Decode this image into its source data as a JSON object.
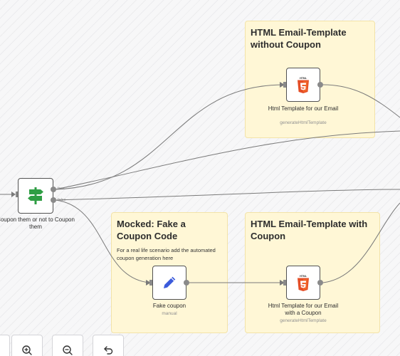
{
  "stickies": {
    "no_coupon": {
      "title": "HTML Email-Template without Coupon"
    },
    "fake_coupon": {
      "title": "Mocked: Fake a Coupon Code",
      "body": "For a real life scenario add the automated coupon generation here"
    },
    "with_coupon": {
      "title": "HTML Email-Template with Coupon"
    }
  },
  "nodes": {
    "switch": {
      "label": "Coupon them or not to Coupon them",
      "branch_true": "true",
      "branch_false": "false",
      "icon": "signpost-icon"
    },
    "html_no_coupon": {
      "label": "Html Template for our Email",
      "subtitle": "generateHtmlTemplate",
      "icon": "html5-icon"
    },
    "fake_coupon": {
      "label": "Fake coupon",
      "subtitle": "manual",
      "icon": "pencil-icon"
    },
    "html_with_coupon": {
      "label": "Html Template for our Email with a Coupon",
      "subtitle": "generateHtmlTemplate",
      "icon": "html5-icon"
    }
  },
  "controls": [
    {
      "name": "zoom-in-button",
      "icon": "zoom-in-icon"
    },
    {
      "name": "zoom-out-button",
      "icon": "zoom-out-icon"
    },
    {
      "name": "undo-button",
      "icon": "undo-icon"
    }
  ],
  "colors": {
    "sticky_bg": "#fff7d6",
    "edge": "#7a7a7a",
    "switch_icon": "#2f9e44",
    "html5_orange": "#e44d26",
    "pencil_blue": "#3b5bdb"
  }
}
